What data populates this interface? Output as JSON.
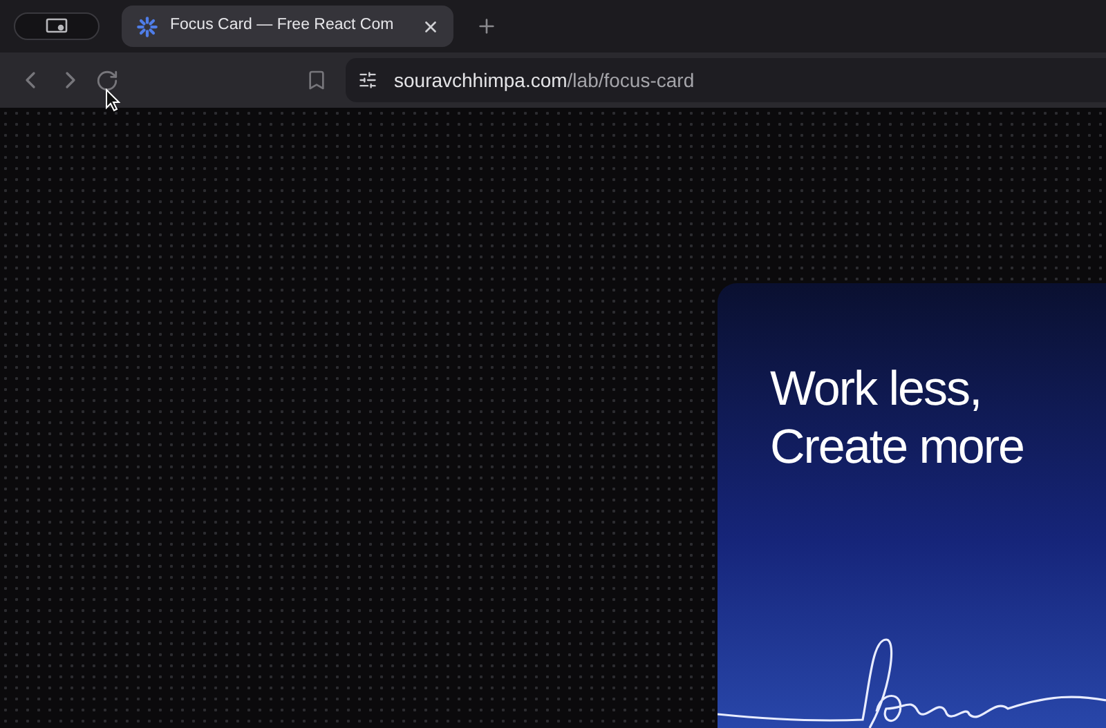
{
  "tabs": [
    {
      "title": "Focus Card — Free React Com",
      "selected": true
    }
  ],
  "address": {
    "domain": "souravchhimpa.com",
    "path": "/lab/focus-card"
  },
  "card": {
    "headline_lines": [
      "Work less,",
      "Create more"
    ]
  }
}
